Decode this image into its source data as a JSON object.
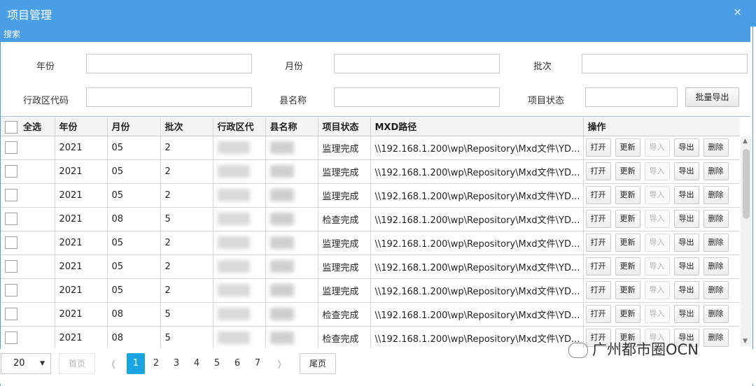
{
  "window": {
    "title": "项目管理",
    "close_glyph": "×"
  },
  "search": {
    "header": "搜索",
    "fields": {
      "year_label": "年份",
      "month_label": "月份",
      "batch_label": "批次",
      "admin_code_label": "行政区代码",
      "county_label": "县名称",
      "status_label": "项目状态"
    },
    "export_button": "批量导出"
  },
  "table": {
    "select_all": "全选",
    "columns": [
      "年份",
      "月份",
      "批次",
      "行政区代",
      "县名称",
      "项目状态",
      "MXD路径",
      "操作"
    ],
    "actions": [
      "打开",
      "更新",
      "导入",
      "导出",
      "删除"
    ],
    "rows": [
      {
        "year": "2021",
        "month": "05",
        "batch": "2",
        "status": "监理完成",
        "path": "\\\\192.168.1.200\\wp\\Repository\\Mxd文件\\YD..."
      },
      {
        "year": "2021",
        "month": "05",
        "batch": "2",
        "status": "监理完成",
        "path": "\\\\192.168.1.200\\wp\\Repository\\Mxd文件\\YD..."
      },
      {
        "year": "2021",
        "month": "05",
        "batch": "2",
        "status": "监理完成",
        "path": "\\\\192.168.1.200\\wp\\Repository\\Mxd文件\\YD..."
      },
      {
        "year": "2021",
        "month": "08",
        "batch": "5",
        "status": "检查完成",
        "path": "\\\\192.168.1.200\\wp\\Repository\\Mxd文件\\YD..."
      },
      {
        "year": "2021",
        "month": "05",
        "batch": "2",
        "status": "监理完成",
        "path": "\\\\192.168.1.200\\wp\\Repository\\Mxd文件\\YD..."
      },
      {
        "year": "2021",
        "month": "05",
        "batch": "2",
        "status": "监理完成",
        "path": "\\\\192.168.1.200\\wp\\Repository\\Mxd文件\\YD..."
      },
      {
        "year": "2021",
        "month": "05",
        "batch": "2",
        "status": "监理完成",
        "path": "\\\\192.168.1.200\\wp\\Repository\\Mxd文件\\YD..."
      },
      {
        "year": "2021",
        "month": "08",
        "batch": "5",
        "status": "检查完成",
        "path": "\\\\192.168.1.200\\wp\\Repository\\Mxd文件\\YD..."
      },
      {
        "year": "2021",
        "month": "08",
        "batch": "5",
        "status": "检查完成",
        "path": "\\\\192.168.1.200\\wp\\Repository\\Mxd文件\\YD..."
      }
    ]
  },
  "pager": {
    "page_size": "20",
    "first_label": "首页",
    "prev_glyph": "❬",
    "pages": [
      "1",
      "2",
      "3",
      "4",
      "5",
      "6",
      "7"
    ],
    "current_page": "1",
    "next_glyph": "❭",
    "last_label": "尾页"
  },
  "watermark": {
    "text": "广州都市圈OCN"
  }
}
